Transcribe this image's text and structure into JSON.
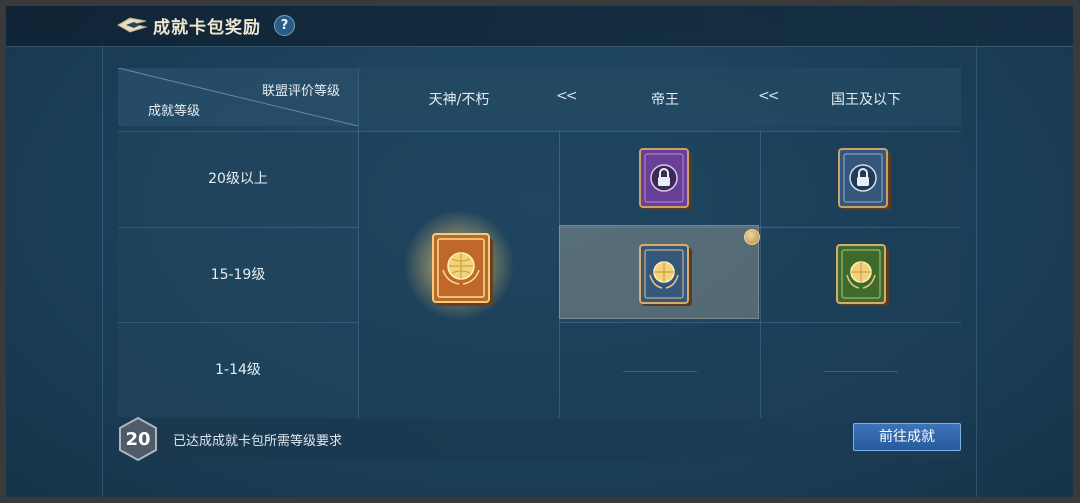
{
  "header": {
    "title": "成就卡包奖励",
    "help_label": "?"
  },
  "table": {
    "corner_top_label": "联盟评价等级",
    "corner_bottom_label": "成就等级",
    "columns": [
      "天神/不朽",
      "帝王",
      "国王及以下"
    ],
    "separator": "<<",
    "rows": [
      "20级以上",
      "15-19级",
      "1-14级"
    ],
    "cells": {
      "tianshen_all": {
        "book": "gold-globe-book",
        "state": "glowing"
      },
      "diwang_20": {
        "book": "purple-locked-book",
        "state": "locked"
      },
      "guowang_20": {
        "book": "blue-locked-book",
        "state": "locked"
      },
      "diwang_15": {
        "book": "blue-globe-book",
        "state": "current"
      },
      "guowang_15": {
        "book": "green-globe-book",
        "state": "available"
      },
      "diwang_1": {
        "book": "",
        "state": "empty"
      },
      "guowang_1": {
        "book": "",
        "state": "empty"
      }
    }
  },
  "footer": {
    "level": "20",
    "status_text": "已达成成就卡包所需等级要求",
    "goto_label": "前往成就"
  },
  "colors": {
    "panel_bg": "#1b3f5a",
    "accent_button": "#2f68ab",
    "title_text": "#f0e6cf"
  }
}
